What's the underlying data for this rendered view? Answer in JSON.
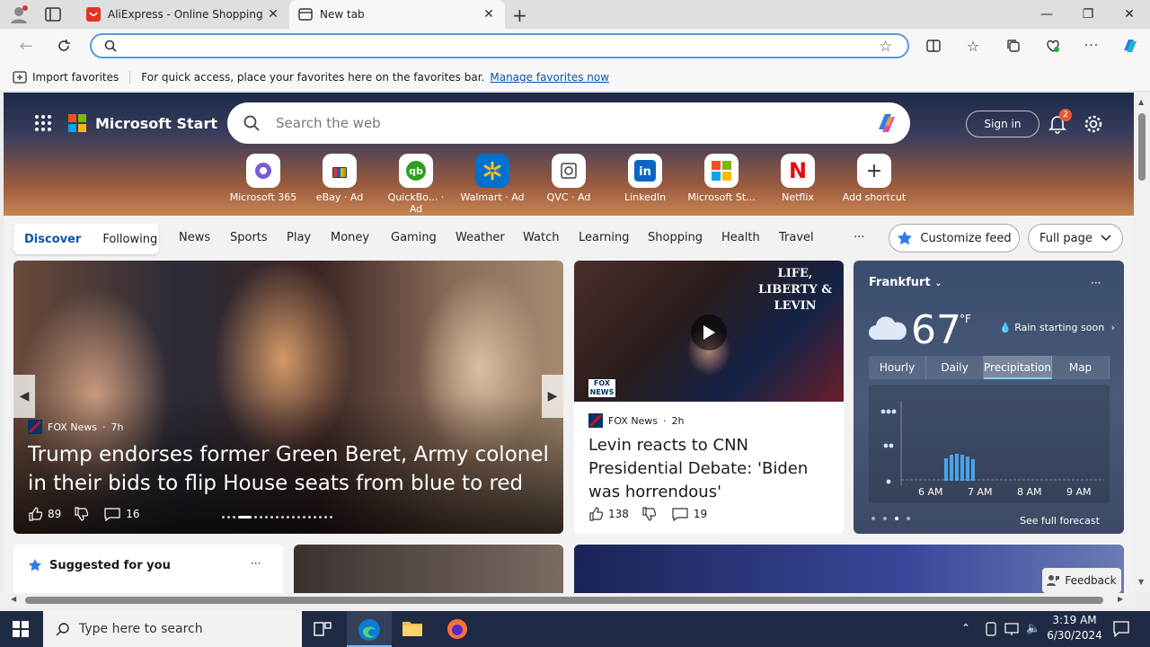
{
  "browser": {
    "tabs": [
      {
        "title": "AliExpress - Online Shopping für",
        "icon": "aliexpress-icon"
      },
      {
        "title": "New tab",
        "icon": "newtab-icon"
      }
    ],
    "favorites_bar": {
      "import_label": "Import favorites",
      "message": "For quick access, place your favorites here on the favorites bar.",
      "link": "Manage favorites now"
    }
  },
  "page": {
    "brand": "Microsoft Start",
    "search_placeholder": "Search the web",
    "sign_in": "Sign in",
    "notification_count": "2",
    "shortcuts": [
      {
        "label": "Microsoft 365",
        "ad": ""
      },
      {
        "label": "eBay",
        "ad": "· Ad"
      },
      {
        "label": "QuickBo...",
        "ad": "· Ad"
      },
      {
        "label": "Walmart",
        "ad": "· Ad"
      },
      {
        "label": "QVC",
        "ad": "· Ad"
      },
      {
        "label": "LinkedIn",
        "ad": ""
      },
      {
        "label": "Microsoft St...",
        "ad": ""
      },
      {
        "label": "Netflix",
        "ad": ""
      },
      {
        "label": "Add shortcut",
        "ad": ""
      }
    ],
    "nav": {
      "discover": "Discover",
      "following": "Following",
      "items": [
        "News",
        "Sports",
        "Play",
        "Money",
        "Gaming",
        "Weather",
        "Watch",
        "Learning",
        "Shopping",
        "Health",
        "Travel"
      ],
      "more": "···",
      "customize": "Customize feed",
      "layout": "Full page"
    },
    "main_story": {
      "source": "FOX News",
      "age": "7h",
      "headline": "Trump endorses former Green Beret, Army colonel in their bids to flip House seats from blue to red",
      "likes": "89",
      "comments": "16"
    },
    "second_story": {
      "source": "FOX News",
      "age": "2h",
      "headline": "Levin reacts to CNN Presidential Debate: 'Biden was horrendous'",
      "likes": "138",
      "comments": "19"
    },
    "weather": {
      "city": "Frankfurt",
      "temp": "67",
      "unit": "°F",
      "condition": "Rain starting soon",
      "tabs": [
        "Hourly",
        "Daily",
        "Precipitation",
        "Map"
      ],
      "active_tab": "Precipitation",
      "times": [
        "6 AM",
        "7 AM",
        "8 AM",
        "9 AM"
      ],
      "see_forecast": "See full forecast"
    },
    "suggested": "Suggested for you",
    "feedback": "Feedback"
  },
  "taskbar": {
    "search_placeholder": "Type here to search",
    "time": "3:19 AM",
    "date": "6/30/2024"
  }
}
